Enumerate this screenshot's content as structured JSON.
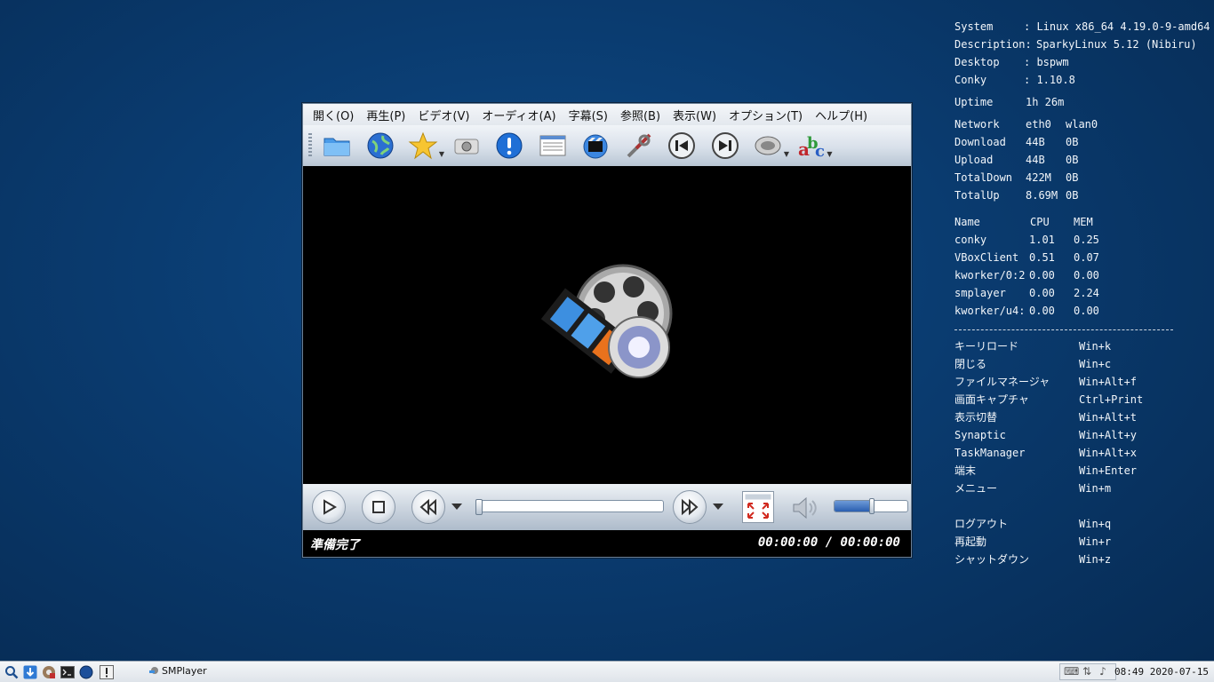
{
  "player": {
    "menu": [
      "開く(O)",
      "再生(P)",
      "ビデオ(V)",
      "オーディオ(A)",
      "字幕(S)",
      "参照(B)",
      "表示(W)",
      "オプション(T)",
      "ヘルプ(H)"
    ],
    "status_left": "準備完了",
    "status_time": "00:00:00 / 00:00:00",
    "volume_level": 0.5,
    "seek_progress": 0.0
  },
  "conky": {
    "system": [
      [
        "System",
        ": Linux x86_64 4.19.0-9-amd64"
      ],
      [
        "Description:",
        "SparkyLinux 5.12 (Nibiru)"
      ],
      [
        "Desktop",
        ": bspwm"
      ],
      [
        "Conky",
        ": 1.10.8"
      ]
    ],
    "uptime": [
      "Uptime",
      "1h 26m"
    ],
    "network": [
      [
        "Network",
        "eth0",
        "wlan0"
      ],
      [
        "Download",
        "44B",
        "0B"
      ],
      [
        "Upload",
        "44B",
        "0B"
      ],
      [
        "TotalDown",
        "422M",
        "0B"
      ],
      [
        "TotalUp",
        "8.69M",
        "0B"
      ]
    ],
    "processes": [
      [
        "Name",
        "CPU",
        "MEM"
      ],
      [
        "conky",
        "1.01",
        "0.25"
      ],
      [
        "VBoxClient",
        "0.51",
        "0.07"
      ],
      [
        "kworker/0:2",
        "0.00",
        "0.00"
      ],
      [
        "smplayer",
        "0.00",
        "2.24"
      ],
      [
        "kworker/u4:",
        "0.00",
        "0.00"
      ]
    ],
    "shortcuts": [
      [
        "キーリロード",
        "Win+k"
      ],
      [
        "閉じる",
        "Win+c"
      ],
      [
        "ファイルマネージャ",
        "Win+Alt+f"
      ],
      [
        "画面キャプチャ",
        "Ctrl+Print"
      ],
      [
        "表示切替",
        "Win+Alt+t"
      ],
      [
        "Synaptic",
        "Win+Alt+y"
      ],
      [
        "TaskManager",
        "Win+Alt+x"
      ],
      [
        "端末",
        "Win+Enter"
      ],
      [
        "メニュー",
        "Win+m"
      ]
    ],
    "session": [
      [
        "ログアウト",
        "Win+q"
      ],
      [
        "再起動",
        "Win+r"
      ],
      [
        "シャットダウン",
        "Win+z"
      ]
    ]
  },
  "taskbar": {
    "task_label": "SMPlayer",
    "clock": "08:49 2020-07-15"
  }
}
